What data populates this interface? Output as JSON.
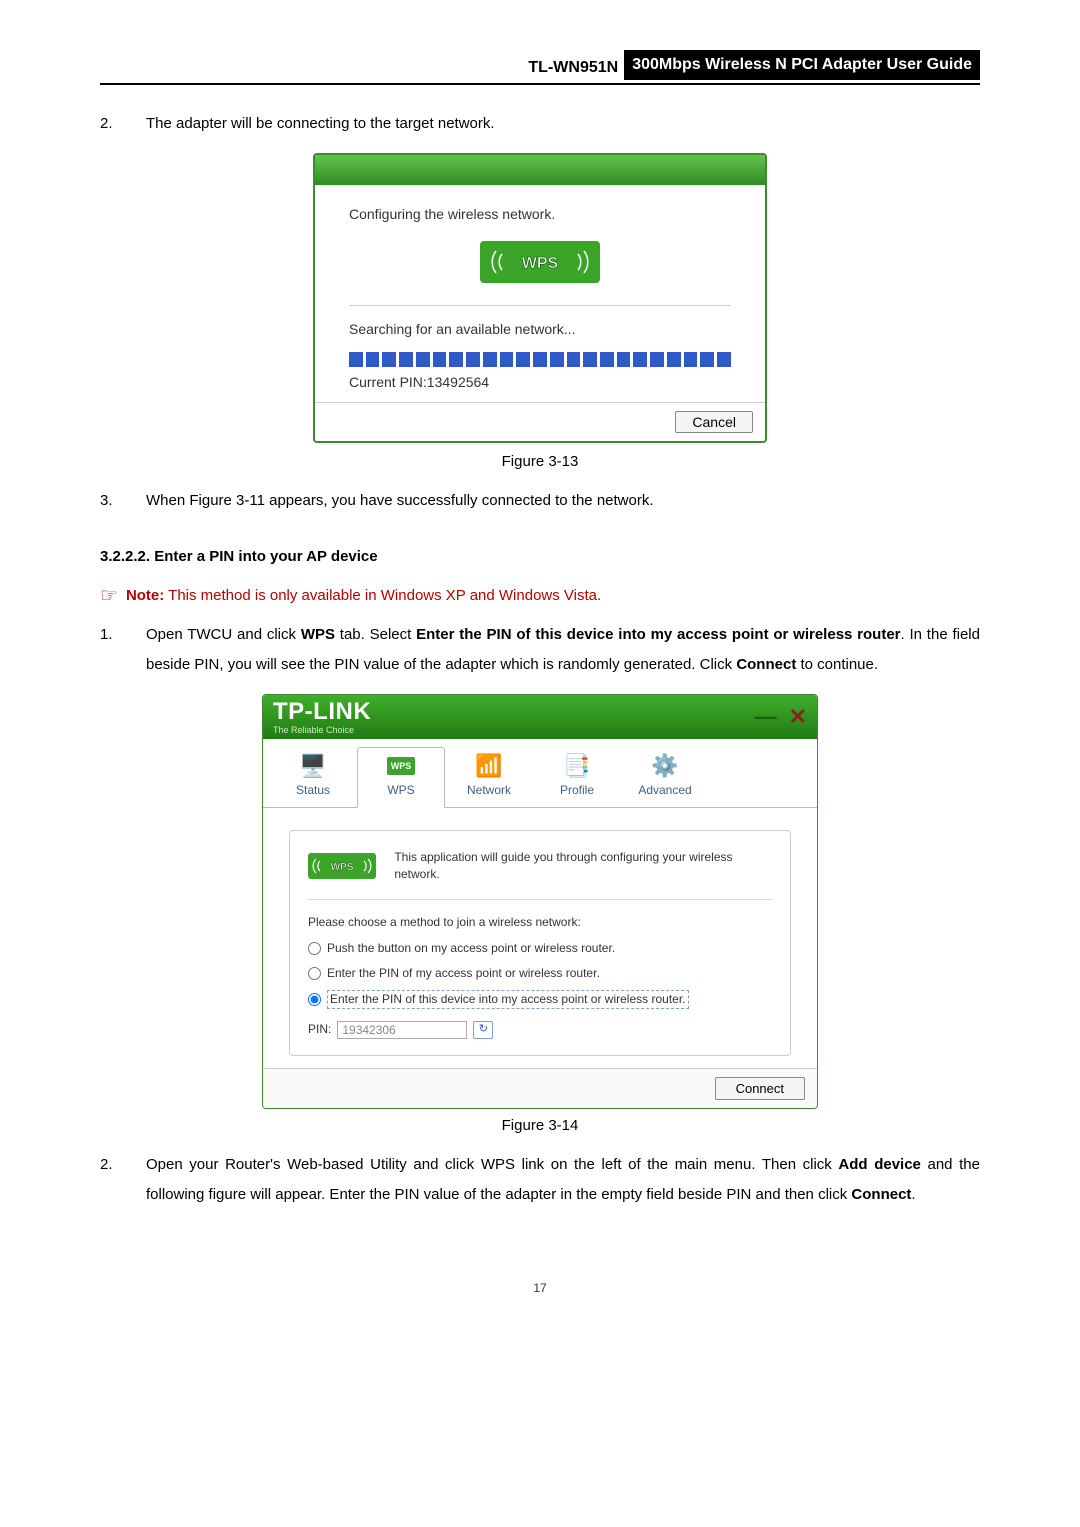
{
  "header": {
    "model": "TL-WN951N",
    "guide_title": "300Mbps Wireless N PCI Adapter User Guide"
  },
  "list_a": {
    "item2_num": "2.",
    "item2_text": "The adapter will be connecting to the target network.",
    "item3_num": "3.",
    "item3_text": "When Figure 3-11 appears, you have successfully connected to the network."
  },
  "dialog1": {
    "configuring_text": "Configuring the wireless network.",
    "status_text": "Searching for an available network...",
    "pin_line": "Current PIN:13492564",
    "cancel_label": "Cancel"
  },
  "fig_caption_13": "Figure 3-13",
  "section_heading": "3.2.2.2.  Enter a PIN into your AP device",
  "note": {
    "label": "Note:",
    "body": "This method is only available in Windows XP and Windows Vista."
  },
  "list_b": {
    "item1_num": "1.",
    "item1_pre": "Open TWCU and click ",
    "item1_bold1": "WPS",
    "item1_mid1": " tab. Select ",
    "item1_bold2": "Enter the PIN of this device into my access point or wireless router",
    "item1_mid2": ". In the field beside PIN, you will see the PIN value of the adapter which is randomly generated. Click ",
    "item1_bold3": "Connect",
    "item1_end": " to continue.",
    "item2_num": "2.",
    "item2_pre": "Open your Router's Web-based Utility and click WPS link on the left of the main menu. Then click ",
    "item2_bold1": "Add device",
    "item2_mid": " and the following figure will appear. Enter the PIN value of the adapter in the empty field beside PIN and then click ",
    "item2_bold2": "Connect",
    "item2_end": "."
  },
  "appwin": {
    "brand": "TP-LINK",
    "brand_sub": "The Reliable Choice",
    "tabs": {
      "status": "Status",
      "wps": "WPS",
      "network": "Network",
      "profile": "Profile",
      "advanced": "Advanced"
    },
    "intro_text": "This application will guide you through configuring your wireless network.",
    "chooser_text": "Please choose a method to join a wireless network:",
    "opt1": "Push the button on my access point or wireless router.",
    "opt2": "Enter the PIN of my access point or wireless router.",
    "opt3": "Enter the PIN of this device into my access point or wireless router.",
    "pin_label": "PIN:",
    "pin_value": "19342306",
    "connect_label": "Connect"
  },
  "fig_caption_14": "Figure 3-14",
  "page_number": "17"
}
